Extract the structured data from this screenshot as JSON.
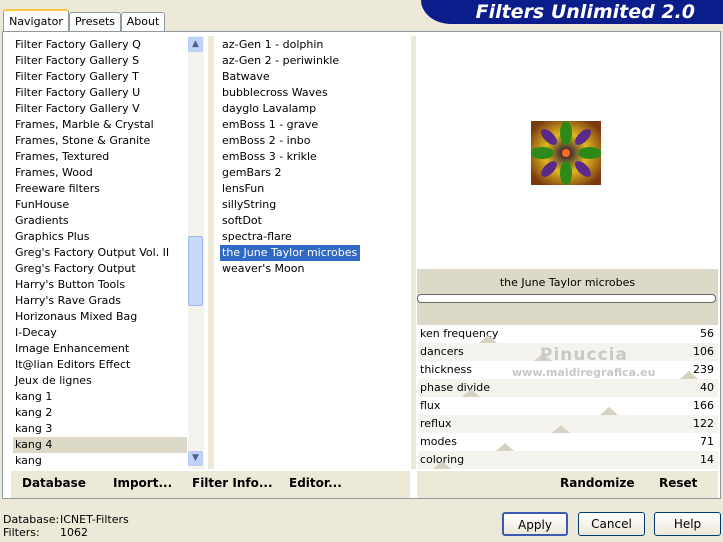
{
  "tabs": [
    {
      "label": "Navigator",
      "active": true
    },
    {
      "label": "Presets",
      "active": false
    },
    {
      "label": "About",
      "active": false
    }
  ],
  "title": "Filters Unlimited 2.0",
  "categories": {
    "items": [
      "Filter Factory Gallery Q",
      "Filter Factory Gallery S",
      "Filter Factory Gallery T",
      "Filter Factory Gallery U",
      "Filter Factory Gallery V",
      "Frames, Marble & Crystal",
      "Frames, Stone & Granite",
      "Frames, Textured",
      "Frames, Wood",
      "Freeware filters",
      "FunHouse",
      "Gradients",
      "Graphics Plus",
      "Greg's Factory Output Vol. II",
      "Greg's Factory Output",
      "Harry's Button Tools",
      "Harry's Rave Grads",
      "Horizonaus Mixed Bag",
      "I-Decay",
      "Image Enhancement",
      "It@lian Editors Effect",
      "Jeux de lignes",
      "kang 1",
      "kang 2",
      "kang 3",
      "kang 4",
      "kang"
    ],
    "selected": "kang 4"
  },
  "filters": {
    "items": [
      "az-Gen 1  -  dolphin",
      "az-Gen 2  -  periwinkle",
      "Batwave",
      "bubblecross Waves",
      "dayglo Lavalamp",
      "emBoss 1  -  grave",
      "emBoss 2  -  inbo",
      "emBoss 3  -  krikle",
      "gemBars 2",
      "lensFun",
      "sillyString",
      "softDot",
      "spectra-flare",
      "the June Taylor microbes",
      "weaver's Moon"
    ],
    "selected": "the June Taylor microbes"
  },
  "preview": {
    "filter_name": "the June Taylor microbes"
  },
  "params": [
    {
      "label": "ken frequency",
      "value": "56"
    },
    {
      "label": "dancers",
      "value": "106"
    },
    {
      "label": "thickness",
      "value": "239"
    },
    {
      "label": "phase divide",
      "value": "40"
    },
    {
      "label": "flux",
      "value": "166"
    },
    {
      "label": "reflux",
      "value": "122"
    },
    {
      "label": "modes",
      "value": "71"
    },
    {
      "label": "coloring",
      "value": "14"
    }
  ],
  "watermark": {
    "name": "Pinuccia",
    "url": "www.maidiregrafica.eu"
  },
  "left_bar": {
    "database": "Database",
    "import": "Import...",
    "filter_info": "Filter Info...",
    "editor": "Editor..."
  },
  "right_bar": {
    "randomize": "Randomize",
    "reset": "Reset"
  },
  "status": {
    "database_label": "Database:",
    "database_value": "ICNET-Filters",
    "filters_label": "Filters:",
    "filters_value": "1062"
  },
  "dialog": {
    "apply": "Apply",
    "cancel": "Cancel",
    "help": "Help"
  }
}
